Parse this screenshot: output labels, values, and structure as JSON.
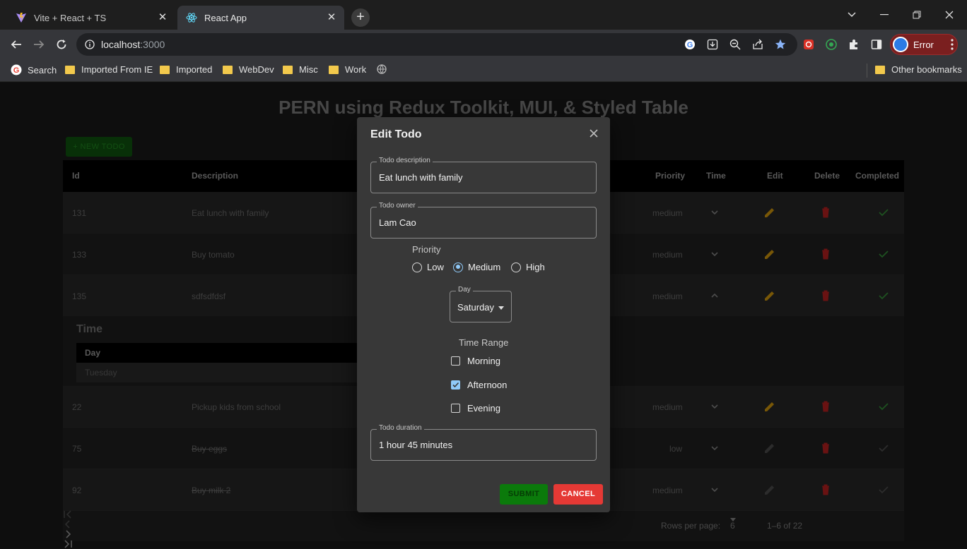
{
  "browser": {
    "tabs": [
      {
        "title": "Vite + React + TS",
        "active": false
      },
      {
        "title": "React App",
        "active": true
      }
    ],
    "address": {
      "host": "localhost",
      "port": ":3000"
    },
    "profile_label": "Error",
    "bookmarks": [
      "Search",
      "Imported From IE",
      "Imported",
      "WebDev",
      "Misc",
      "Work"
    ],
    "other_bookmarks": "Other bookmarks"
  },
  "page": {
    "title": "PERN using Redux Toolkit, MUI, & Styled Table",
    "new_todo_label": "+ NEW TODO",
    "columns": [
      "Id",
      "Description",
      "Priority",
      "Time",
      "Edit",
      "Delete",
      "Completed"
    ],
    "rows": [
      {
        "id": "131",
        "description": "Eat lunch with family",
        "priority": "medium",
        "completed": true
      },
      {
        "id": "133",
        "description": "Buy tomato",
        "priority": "medium",
        "completed": true
      },
      {
        "id": "135",
        "description": "sdfsdfdsf",
        "priority": "medium",
        "completed": true
      },
      {
        "id": "22",
        "description": "Pickup kids from school",
        "priority": "medium",
        "completed": true
      },
      {
        "id": "75",
        "description": "Buy eggs",
        "priority": "low",
        "completed": false
      },
      {
        "id": "92",
        "description": "Buy milk 2",
        "priority": "medium",
        "completed": false
      }
    ],
    "time_panel": {
      "title": "Time",
      "header": "Day",
      "value": "Tuesday"
    },
    "pagination": {
      "rows_per_page_label": "Rows per page:",
      "rows_per_page": "6",
      "range": "1–6 of 22"
    }
  },
  "dialog": {
    "title": "Edit Todo",
    "description_label": "Todo description",
    "description_value": "Eat lunch with family",
    "owner_label": "Todo owner",
    "owner_value": "Lam Cao",
    "priority_label": "Priority",
    "priority_options": [
      "Low",
      "Medium",
      "High"
    ],
    "priority_selected": "Medium",
    "day_label": "Day",
    "day_value": "Saturday",
    "time_range_label": "Time Range",
    "time_range_options": [
      {
        "label": "Morning",
        "checked": false
      },
      {
        "label": "Afternoon",
        "checked": true
      },
      {
        "label": "Evening",
        "checked": false
      }
    ],
    "duration_label": "Todo duration",
    "duration_value": "1 hour 45 minutes",
    "submit_label": "SUBMIT",
    "cancel_label": "CANCEL"
  },
  "colors": {
    "accent": "#90caf9",
    "edit_icon": "#b8860b",
    "delete_icon": "#a21d1d",
    "complete_icon": "#2e7d32",
    "cancel": "#e53935",
    "submit": "#0b7a0b"
  }
}
